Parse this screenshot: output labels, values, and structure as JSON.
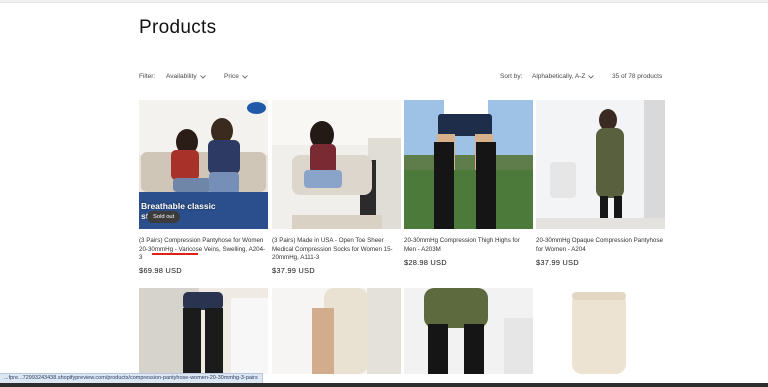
{
  "page": {
    "title": "Products"
  },
  "filters": {
    "filter_label": "Filter:",
    "availability_label": "Availability",
    "price_label": "Price",
    "sort_label": "Sort by:",
    "sort_value": "Alphabetically, A-Z",
    "product_count": "35 of 78 products"
  },
  "products": [
    {
      "name": "(3 Pairs) Compression Pantyhose for Women 20-30mmHg - Varicose Veins, Swelling, A204-3",
      "price": "$69.98 USD",
      "badge": "Sold out",
      "promo_text": "Breathable classic\nstyling"
    },
    {
      "name": "(3 Pairs) Made in USA - Open Toe Sheer Medical Compression Socks for Women 15-20mmHg, A111-3",
      "price": "$37.99 USD"
    },
    {
      "name": "20-30mmHg Compression Thigh Highs for Men - A203M",
      "price": "$28.98 USD"
    },
    {
      "name": "20-30mmHg Opaque Compression Pantyhose for Women - A204",
      "price": "$37.99 USD"
    }
  ],
  "status_url": "...fpre...72993243438.shopifypreview.com/products/compression-pantyhose-women-20-30mmhg-3-pairs",
  "colors": {
    "accent_underline": "#e0201b",
    "status_bar_bg": "#dde6f3"
  }
}
